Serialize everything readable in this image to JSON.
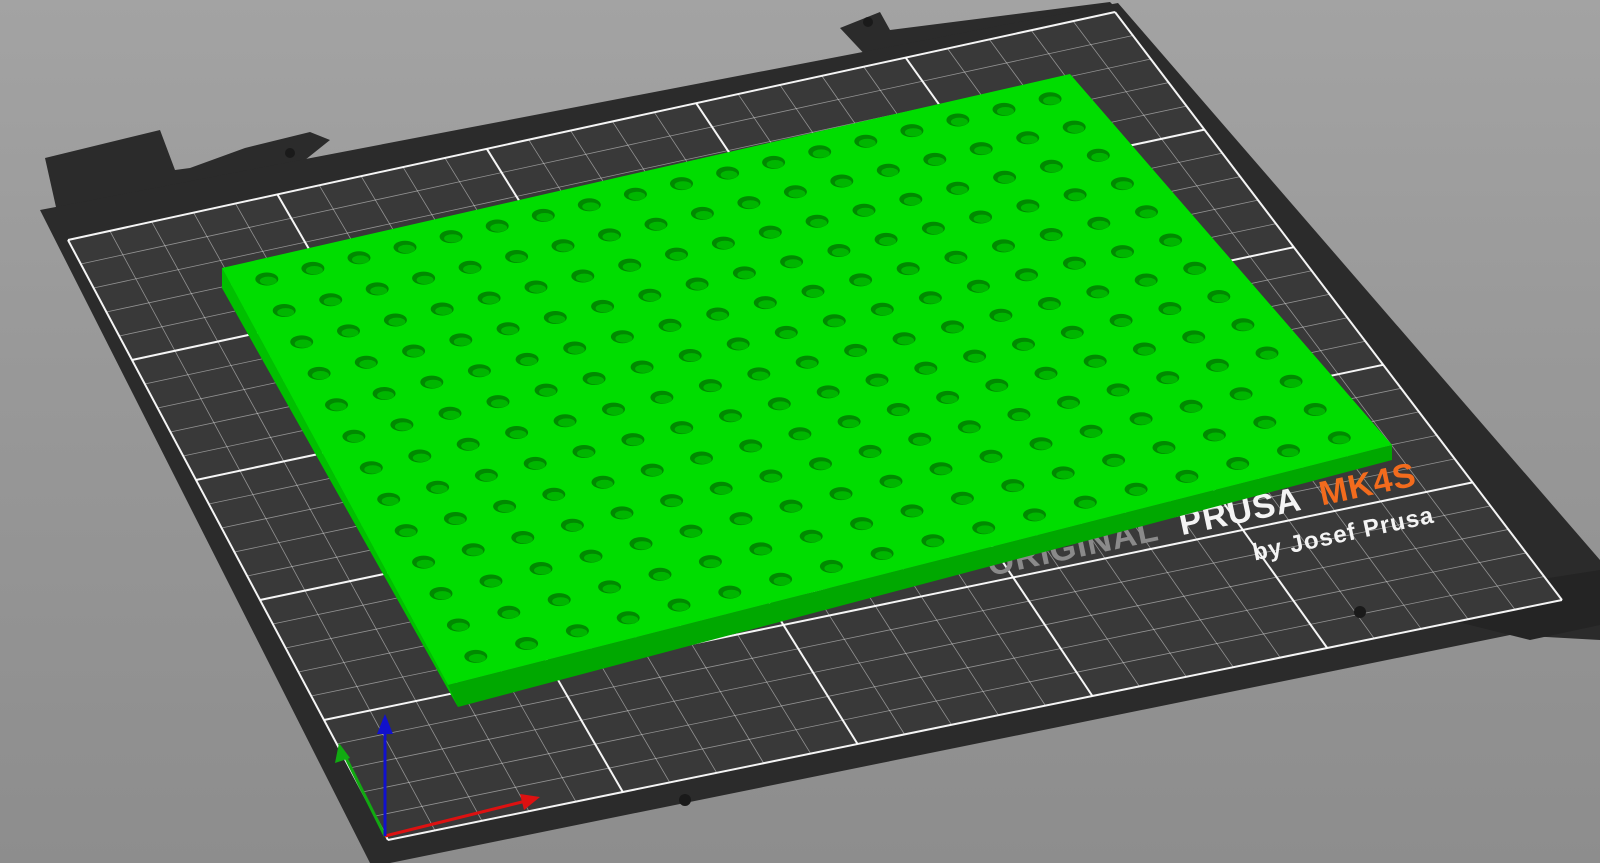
{
  "viewport": {
    "background": "#999999"
  },
  "bed": {
    "plate_color": "#2e2e2e",
    "sheet_color": "#3a3a3a",
    "grid_color": "#ffffff",
    "logo": {
      "line1_gray": "ORIGINAL",
      "line1_white": "PRUSA",
      "line1_orange": "MK4S",
      "line2": "by Josef Prusa",
      "accent": "#f26b1d"
    }
  },
  "model": {
    "color": "#00dd00",
    "side_color": "#00aa00",
    "hole_color": "#008a00",
    "hole_rows": 13,
    "hole_cols": 18
  },
  "axes": {
    "x_color": "#dd1111",
    "y_color": "#11aa11",
    "z_color": "#1111cc"
  }
}
